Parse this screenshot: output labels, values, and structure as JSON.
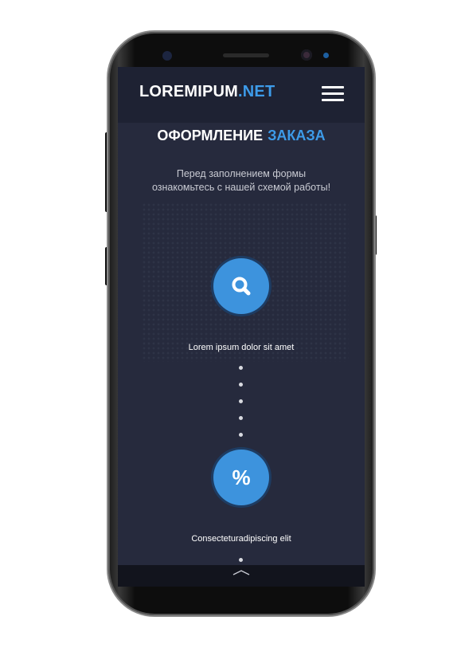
{
  "header": {
    "logo_main": "LOREMIPUM",
    "logo_accent": ".NET",
    "menu_icon": "hamburger-menu-icon"
  },
  "section": {
    "title_main": "ОФОРМЛЕНИЕ",
    "title_accent": "ЗАКАЗА",
    "intro_line1": "Перед заполнением формы",
    "intro_line2": "ознакомьтесь с нашей схемой работы!"
  },
  "steps": [
    {
      "icon": "search-icon",
      "label": "Lorem ipsum dolor sit amet"
    },
    {
      "icon": "percent-icon",
      "glyph": "%",
      "label": "Consecteturadipiscing elit"
    }
  ],
  "bottom_bar": {
    "icon": "chevron-up-icon"
  },
  "colors": {
    "accent": "#3d9be9",
    "circle": "#3d93dd",
    "screen_bg": "#262a3d",
    "header_bg": "#1e2233"
  }
}
